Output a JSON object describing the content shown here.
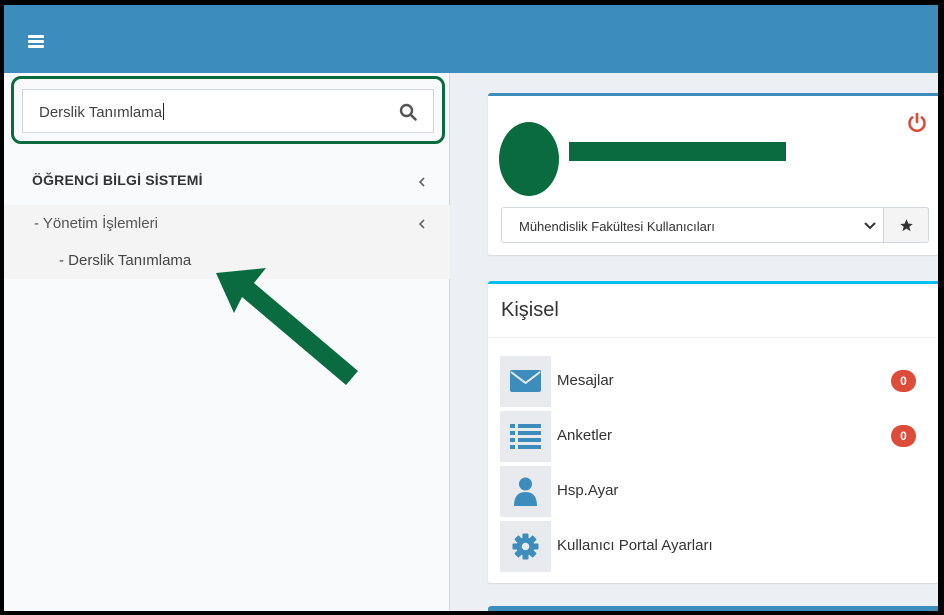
{
  "search": {
    "value": "Derslik Tanımlama"
  },
  "sidebar": {
    "header": "ÖĞRENCİ BİLGİ SİSTEMİ",
    "items": [
      {
        "label": "- Yönetim İşlemleri"
      },
      {
        "label": "- Derslik Tanımlama"
      }
    ]
  },
  "profile": {
    "selected_role": "Mühendislik Fakültesi Kullanıcıları"
  },
  "personal": {
    "title": "Kişisel",
    "items": [
      {
        "label": "Mesajlar",
        "icon": "envelope-icon",
        "badge": "0"
      },
      {
        "label": "Anketler",
        "icon": "list-icon",
        "badge": "0"
      },
      {
        "label": "Hsp.Ayar",
        "icon": "user-icon"
      },
      {
        "label": "Kullanıcı Portal Ayarları",
        "icon": "gear-icon"
      }
    ]
  },
  "colors": {
    "header": "#3c8dbc",
    "highlight": "#0a6b40",
    "badge": "#dd4b39",
    "accent_info": "#00c0ef"
  }
}
